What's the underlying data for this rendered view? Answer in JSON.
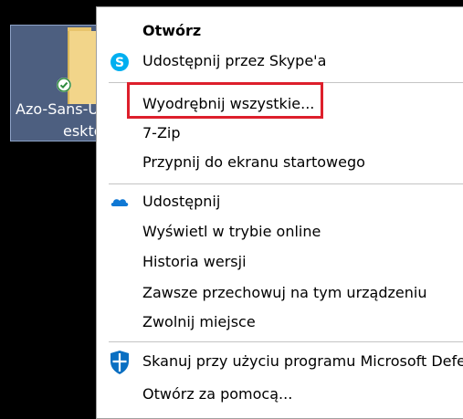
{
  "desktop": {
    "icon_label_line1": "Azo-Sans-U",
    "icon_label_line2": "eskto",
    "icon": "folder-icon",
    "sync_status_icon": "synced-check-icon"
  },
  "context_menu": {
    "items": [
      {
        "label": "Otwórz",
        "icon": null,
        "bold": true
      },
      {
        "label": "Udostępnij przez Skype'a",
        "icon": "skype-icon"
      },
      {
        "label": "Wyodrębnij wszystkie...",
        "icon": null,
        "highlighted": true
      },
      {
        "label": "7-Zip",
        "icon": null
      },
      {
        "label": "Przypnij do ekranu startowego",
        "icon": null
      },
      {
        "label": "Udostępnij",
        "icon": "onedrive-cloud-icon"
      },
      {
        "label": "Wyświetl w trybie online",
        "icon": null
      },
      {
        "label": "Historia wersji",
        "icon": null
      },
      {
        "label": "Zawsze przechowuj na tym urządzeniu",
        "icon": null
      },
      {
        "label": "Zwolnij miejsce",
        "icon": null
      },
      {
        "label": "Skanuj przy użyciu programu Microsoft Defe",
        "icon": "defender-shield-icon"
      },
      {
        "label": "Otwórz za pomocą...",
        "icon": null
      }
    ]
  },
  "colors": {
    "highlight_border": "#dd1f2b",
    "skype_blue": "#00aff0",
    "onedrive_blue": "#0f78d4",
    "defender_blue": "#0a6fc2",
    "desktop_background": "#000000",
    "icon_selection": "#4d5f80"
  }
}
